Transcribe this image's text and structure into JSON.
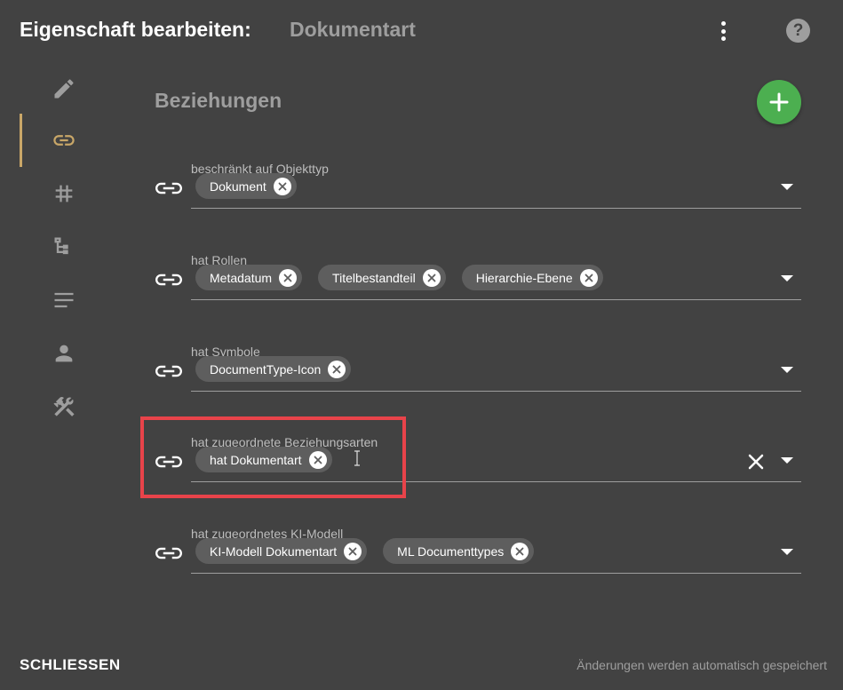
{
  "header": {
    "title": "Eigenschaft bearbeiten:",
    "subtitle": "Dokumentart",
    "menu_icon": "kebab-icon",
    "help_label": "?",
    "help_icon": "help-icon"
  },
  "sidebar": {
    "items": [
      {
        "icon": "pencil-icon",
        "active": false
      },
      {
        "icon": "link-icon",
        "active": true
      },
      {
        "icon": "hash-icon",
        "active": false
      },
      {
        "icon": "tree-icon",
        "active": false
      },
      {
        "icon": "lines-icon",
        "active": false
      },
      {
        "icon": "person-icon",
        "active": false
      },
      {
        "icon": "tools-icon",
        "active": false
      }
    ],
    "active_color": "#c9a768"
  },
  "main": {
    "section_title": "Beziehungen",
    "add_button_color": "#4caf50",
    "fields": [
      {
        "label": "beschränkt auf Objekttyp",
        "chips": [
          "Dokument"
        ]
      },
      {
        "label": "hat Rollen",
        "chips": [
          "Metadatum",
          "Titelbestandteil",
          "Hierarchie-Ebene"
        ]
      },
      {
        "label": "hat Symbole",
        "chips": [
          "DocumentType-Icon"
        ]
      },
      {
        "label": "hat zugeordnete Beziehungsarten",
        "chips": [
          "hat Dokumentart"
        ]
      },
      {
        "label": "hat zugeordnetes KI-Modell",
        "chips": [
          "KI-Modell Dokumentart",
          "ML Documenttypes"
        ]
      }
    ]
  },
  "highlight_color": "#e8434a",
  "footer": {
    "close_label": "SCHLIESSEN",
    "status": "Änderungen werden automatisch gespeichert"
  }
}
